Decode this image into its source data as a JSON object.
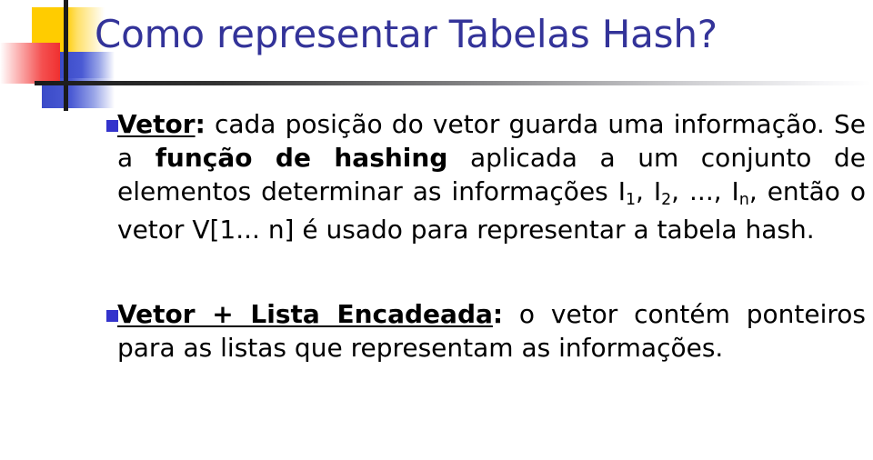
{
  "slide": {
    "title": "Como representar Tabelas Hash?",
    "title_color": "#333399",
    "background_color": "#ffffff",
    "bullet_marker_color": "#3333CC",
    "logo": {
      "yellow": "#FFCC00",
      "red": "#F03030",
      "blue": "#3B4BC8",
      "bar": "#1a1a1a"
    }
  },
  "bullets": [
    {
      "marker": "square-bullet-icon",
      "lead_bold_underlined": "Vetor",
      "lead_colon": ":",
      "text_part_1": " cada posição do vetor guarda uma informação. Se a ",
      "bold_phrase": "função de hashing",
      "text_part_2": " aplicada a um conjunto de elementos determinar as informações I",
      "sub_1": "1",
      "text_part_3": ", I",
      "sub_2": "2",
      "text_part_4": ", ..., I",
      "sub_3": "n",
      "text_part_5": ", então o vetor V[1... n] é usado para representar a tabela hash.",
      "full_text": "Vetor: cada posição do vetor guarda uma informação. Se a função de hashing aplicada a um conjunto de elementos determinar as informações I1, I2, ..., In, então o vetor V[1... n] é usado para representar a tabela hash."
    },
    {
      "marker": "square-bullet-icon",
      "lead_bold_underlined": "Vetor + Lista Encadeada",
      "lead_colon": ":",
      "text_part_1": " o vetor contém ponteiros para as listas que representam as informações.",
      "full_text": "Vetor + Lista Encadeada: o vetor contém ponteiros para as listas que representam as informações."
    }
  ]
}
